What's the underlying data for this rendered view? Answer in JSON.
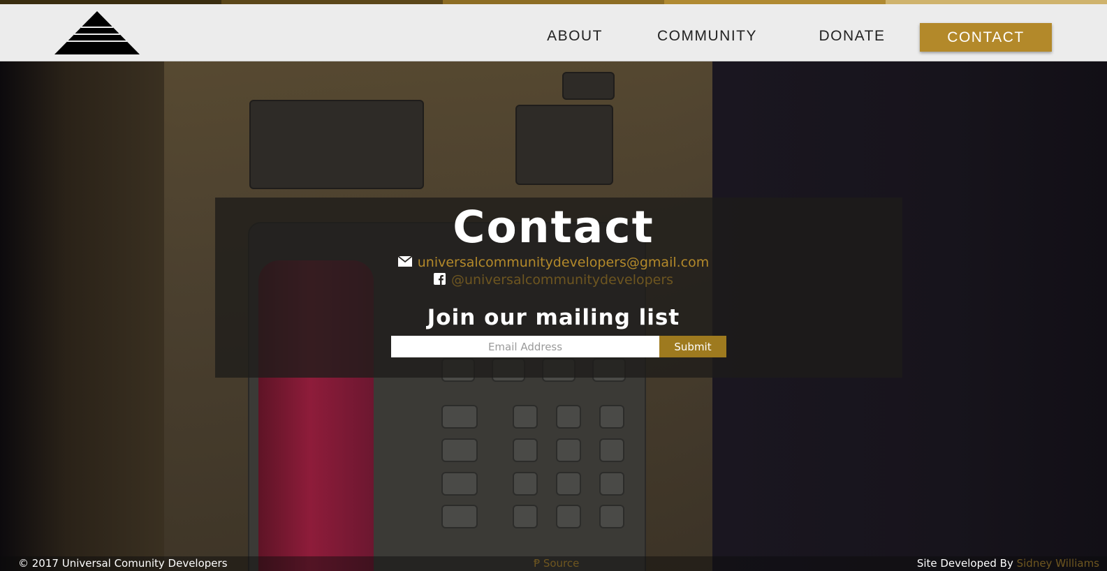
{
  "colors": {
    "accent": "#b3892a",
    "accent_dark": "#6e5620",
    "header_bg": "#ececec",
    "strip": [
      "#3b2f12",
      "#5a461b",
      "#8a6b25",
      "#b3892a",
      "#d2b56c"
    ]
  },
  "header": {
    "logo_icon": "pyramid-logo-icon",
    "nav": [
      {
        "label": "ABOUT"
      },
      {
        "label": "COMMUNITY"
      },
      {
        "label": "DONATE"
      },
      {
        "label": "CONTACT"
      }
    ]
  },
  "contact": {
    "title": "Contact",
    "email_icon": "envelope-icon",
    "email": "universalcommunitydevelopers@gmail.com",
    "facebook_icon": "facebook-icon",
    "facebook": "@universalcommunitydevelopers",
    "mailing_title": "Join our mailing list",
    "email_placeholder": "Email Address",
    "submit_label": "Submit"
  },
  "footer": {
    "copyright": "© 2017 Universal Comunity Developers",
    "source_icon": "source-icon",
    "source_label": "Source",
    "developed_by": "Site Developed By",
    "developer": "Sidney Williams"
  }
}
